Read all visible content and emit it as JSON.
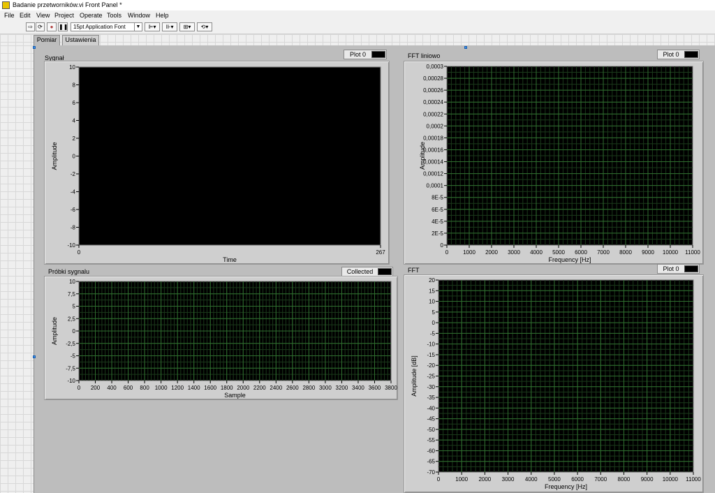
{
  "window": {
    "title": "Badanie przetworników.vi Front Panel *"
  },
  "menu": [
    "File",
    "Edit",
    "View",
    "Project",
    "Operate",
    "Tools",
    "Window",
    "Help"
  ],
  "toolbar": {
    "font": "15pt Application Font"
  },
  "tabs": [
    {
      "label": "Pomiar",
      "active": true
    },
    {
      "label": "Ustawienia",
      "active": false
    }
  ],
  "graphs": {
    "sygnal": {
      "label": "Sygnał",
      "legend": "Plot 0",
      "xlabel": "Time",
      "ylabel": "Amplitude",
      "yticks": [
        "10",
        "8",
        "6",
        "4",
        "2",
        "0",
        "-2",
        "-4",
        "-6",
        "-8",
        "-10"
      ],
      "xticks": [
        "0",
        "267"
      ],
      "grid": false
    },
    "probki": {
      "label": "Próbki sygnalu",
      "legend": "Collected",
      "xlabel": "Sample",
      "ylabel": "Amplitude",
      "yticks": [
        "10",
        "7,5",
        "5",
        "2,5",
        "0",
        "-2,5",
        "-5",
        "-7,5",
        "-10"
      ],
      "xticks": [
        "0",
        "200",
        "400",
        "600",
        "800",
        "1000",
        "1200",
        "1400",
        "1600",
        "1800",
        "2000",
        "2200",
        "2400",
        "2600",
        "2800",
        "3000",
        "3200",
        "3400",
        "3600",
        "3800"
      ],
      "grid": true
    },
    "fft_liniowo": {
      "label": "FFT liniowo",
      "legend": "Plot 0",
      "xlabel": "Frequency [Hz]",
      "ylabel": "Amplitude",
      "yticks": [
        "0,0003",
        "0,00028",
        "0,00026",
        "0,00024",
        "0,00022",
        "0,0002",
        "0,00018",
        "0,00016",
        "0,00014",
        "0,00012",
        "0,0001",
        "8E-5",
        "6E-5",
        "4E-5",
        "2E-5",
        "0"
      ],
      "xticks": [
        "0",
        "1000",
        "2000",
        "3000",
        "4000",
        "5000",
        "6000",
        "7000",
        "8000",
        "9000",
        "10000",
        "11000"
      ],
      "grid": true
    },
    "fft": {
      "label": "FFT",
      "legend": "Plot 0",
      "xlabel": "Frequency [Hz]",
      "ylabel": "Amplitude [dB]",
      "yticks": [
        "20",
        "15",
        "10",
        "5",
        "0",
        "-5",
        "-10",
        "-15",
        "-20",
        "-25",
        "-30",
        "-35",
        "-40",
        "-45",
        "-50",
        "-55",
        "-60",
        "-65",
        "-70"
      ],
      "xticks": [
        "0",
        "1000",
        "2000",
        "3000",
        "4000",
        "5000",
        "6000",
        "7000",
        "8000",
        "9000",
        "10000",
        "11000"
      ],
      "grid": true
    }
  }
}
